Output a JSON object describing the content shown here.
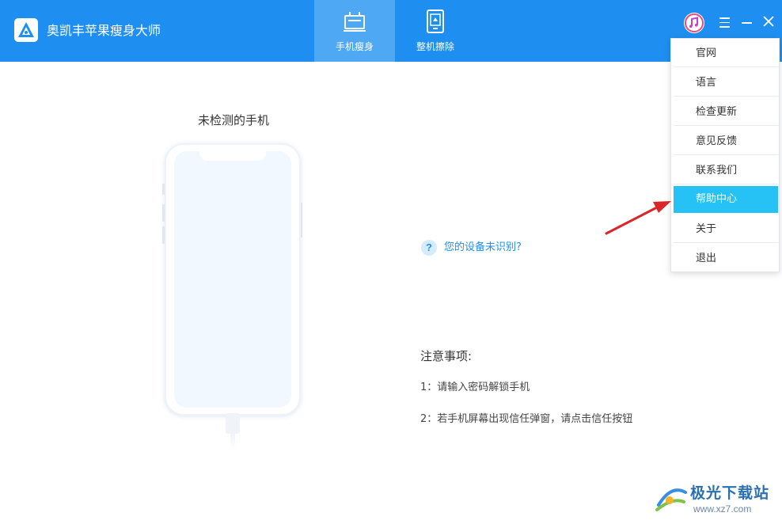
{
  "header": {
    "title": "奥凯丰苹果瘦身大师",
    "tabs": [
      {
        "label": "手机瘦身",
        "active": true
      },
      {
        "label": "整机擦除",
        "active": false
      }
    ],
    "color": "#1e8ff0"
  },
  "device": {
    "status_title": "未检测的手机"
  },
  "help": {
    "link_text": "您的设备未识别?",
    "icon_glyph": "?"
  },
  "notes": {
    "title": "注意事项:",
    "items": [
      "1：请输入密码解锁手机",
      "2：若手机屏幕出现信任弹窗，请点击信任按钮"
    ]
  },
  "menu": {
    "items": [
      {
        "label": "官网"
      },
      {
        "label": "语言"
      },
      {
        "label": "检查更新"
      },
      {
        "label": "意见反馈"
      },
      {
        "label": "联系我们"
      },
      {
        "label": "帮助中心",
        "highlighted": true
      },
      {
        "label": "关于"
      },
      {
        "label": "退出"
      }
    ],
    "highlight_color": "#26c2f6"
  },
  "watermark": {
    "text": "极光下载站",
    "url": "www.xz7.com"
  }
}
